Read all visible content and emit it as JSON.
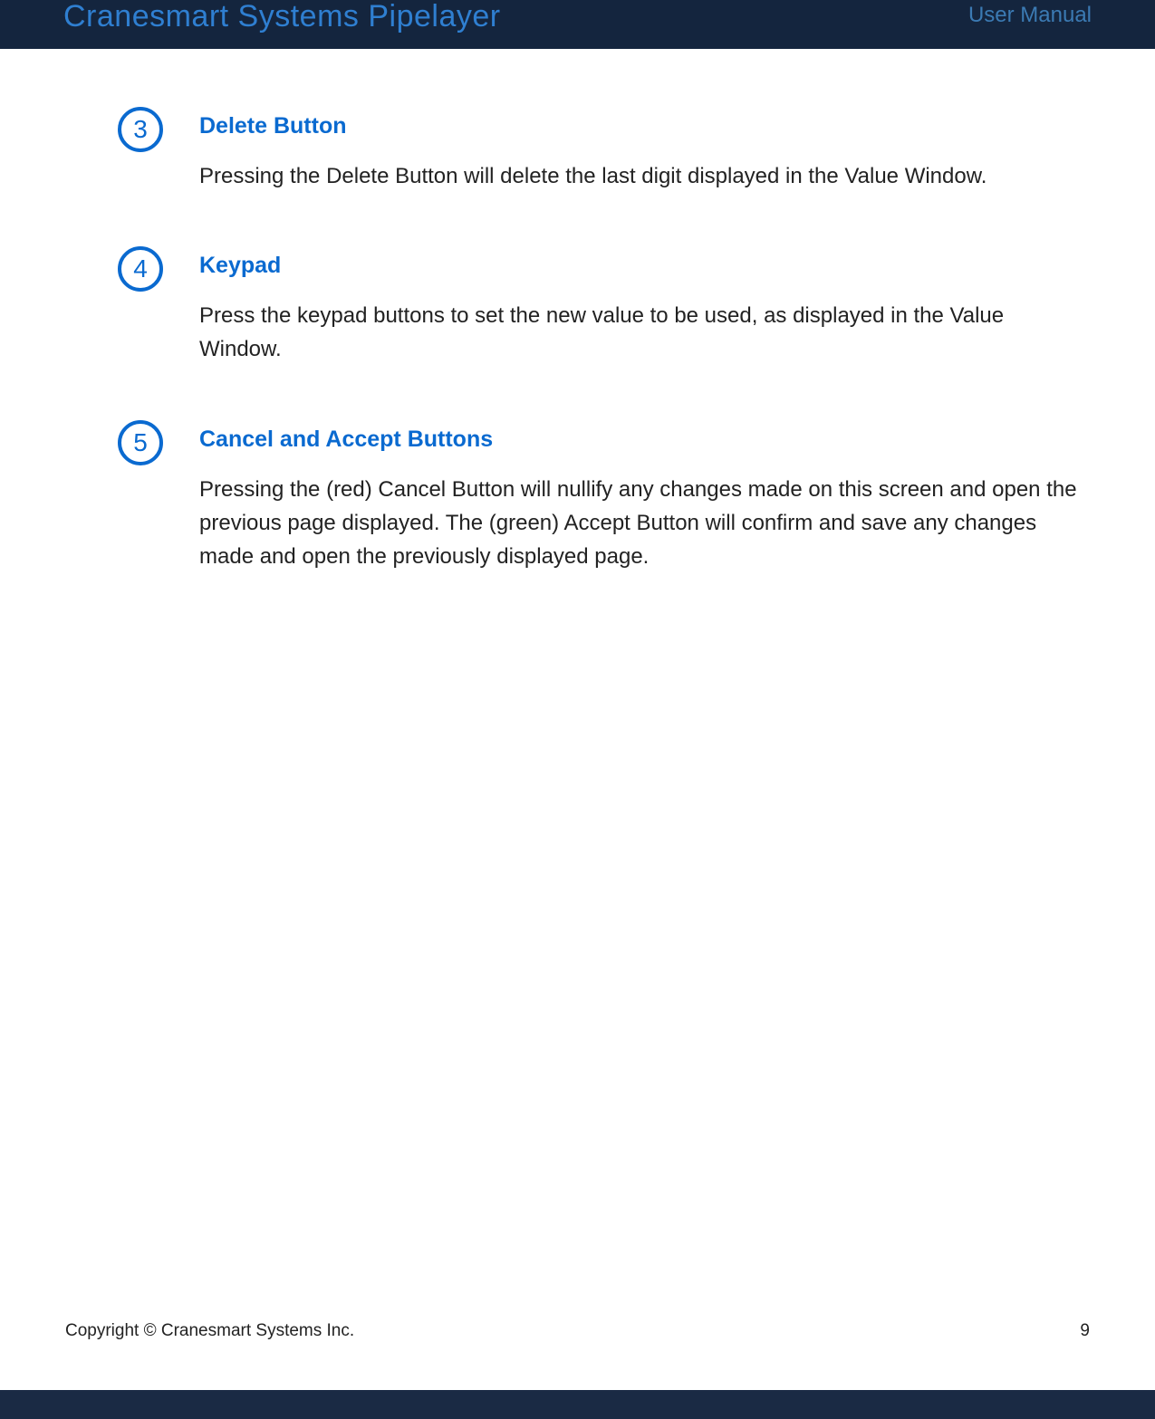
{
  "header": {
    "title": "Cranesmart Systems Pipelayer",
    "subtitle": "User Manual"
  },
  "items": [
    {
      "num": "3",
      "heading": "Delete Button",
      "text": "Pressing the Delete Button will delete the last digit displayed in the Value Window."
    },
    {
      "num": "4",
      "heading": "Keypad",
      "text": "Press the keypad buttons to set the new value to be used, as displayed in the Value Window."
    },
    {
      "num": "5",
      "heading": "Cancel and Accept Buttons",
      "text": "Pressing the (red) Cancel Button will nullify any changes made on this screen and open the previous page displayed.  The (green) Accept Button will confirm and save any changes made and open the previously displayed page."
    }
  ],
  "footer": {
    "copyright": "Copyright © Cranesmart Systems Inc.",
    "page": "9"
  }
}
